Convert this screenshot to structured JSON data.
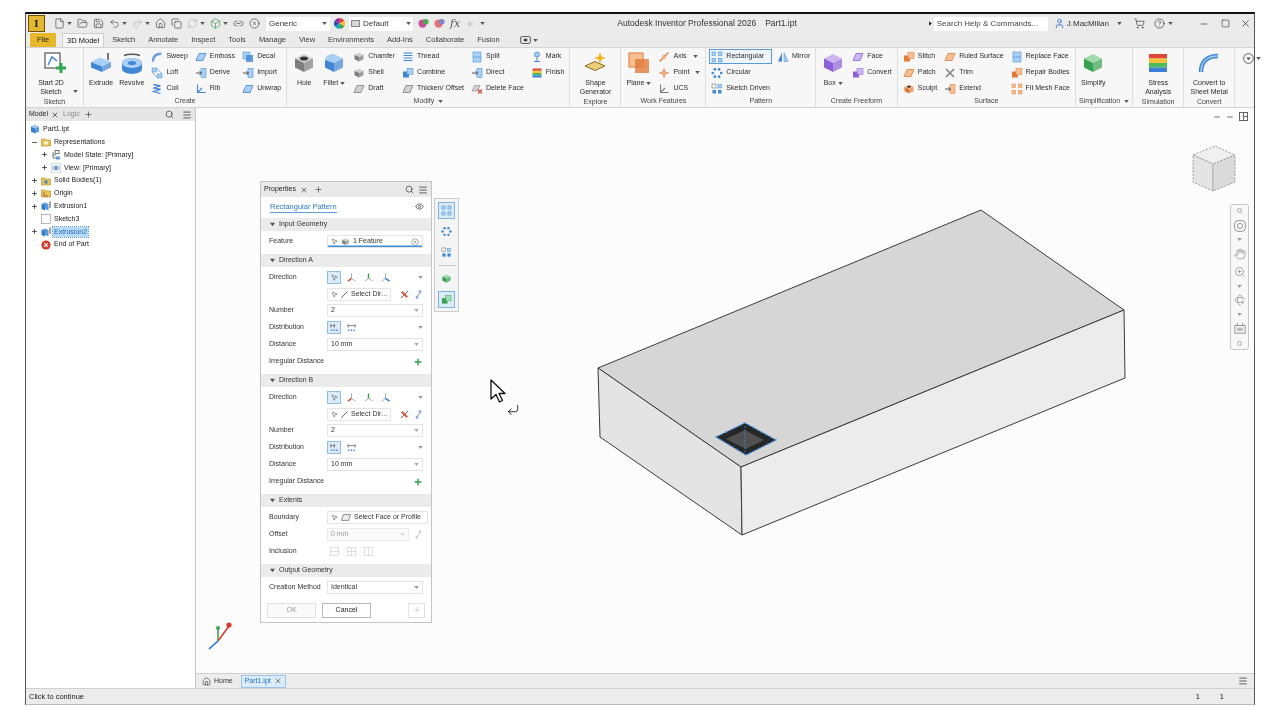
{
  "title_bar": {
    "app_logo": "I",
    "material": "Generic",
    "appearance": "Default",
    "parameters": "fx",
    "title": "Autodesk Inventor Professional 2026",
    "document": "Part1.ipt",
    "search": {
      "placeholder": "Search Help & Commands..."
    },
    "user": "J.MacMillan"
  },
  "ribbon_tabs": [
    {
      "label": "File",
      "kind": "file",
      "selected": false
    },
    {
      "label": "3D Model",
      "kind": "tab",
      "selected": true
    },
    {
      "label": "Sketch",
      "kind": "tab",
      "selected": false
    },
    {
      "label": "Annotate",
      "kind": "tab",
      "selected": false
    },
    {
      "label": "Inspect",
      "kind": "tab",
      "selected": false
    },
    {
      "label": "Tools",
      "kind": "tab",
      "selected": false
    },
    {
      "label": "Manage",
      "kind": "tab",
      "selected": false
    },
    {
      "label": "View",
      "kind": "tab",
      "selected": false
    },
    {
      "label": "Environments",
      "kind": "tab",
      "selected": false
    },
    {
      "label": "Add-Ins",
      "kind": "tab",
      "selected": false
    },
    {
      "label": "Collaborate",
      "kind": "tab",
      "selected": false
    },
    {
      "label": "Fusion",
      "kind": "tab",
      "selected": false
    }
  ],
  "ribbon_panels": [
    {
      "label": "Sketch",
      "columns": [
        {
          "kind": "large",
          "tools": [
            {
              "label": "Start 2D Sketch",
              "dropdown": true,
              "selected": false
            }
          ]
        }
      ]
    },
    {
      "label": "Create",
      "columns": [
        {
          "kind": "large",
          "tools": [
            {
              "label": "Extrude",
              "selected": false
            },
            {
              "label": "Revolve",
              "selected": false
            }
          ]
        },
        {
          "kind": "small",
          "tools": [
            {
              "label": "Sweep",
              "selected": false
            },
            {
              "label": "Loft",
              "selected": false
            },
            {
              "label": "Coil",
              "selected": false
            }
          ]
        },
        {
          "kind": "small",
          "tools": [
            {
              "label": "Emboss",
              "selected": false
            },
            {
              "label": "Derive",
              "selected": false
            },
            {
              "label": "Rib",
              "selected": false
            }
          ]
        },
        {
          "kind": "small",
          "tools": [
            {
              "label": "Decal",
              "selected": false
            },
            {
              "label": "Import",
              "selected": false
            },
            {
              "label": "Unwrap",
              "selected": false
            }
          ]
        }
      ]
    },
    {
      "label": "Modify",
      "menu": true,
      "columns": [
        {
          "kind": "large",
          "tools": [
            {
              "label": "Hole",
              "selected": false
            },
            {
              "label": "Fillet",
              "dropdown": true,
              "selected": false
            }
          ]
        },
        {
          "kind": "small",
          "tools": [
            {
              "label": "Chamfer",
              "selected": false
            },
            {
              "label": "Shell",
              "selected": false
            },
            {
              "label": "Draft",
              "selected": false
            }
          ]
        },
        {
          "kind": "small",
          "tools": [
            {
              "label": "Thread",
              "selected": false
            },
            {
              "label": "Combine",
              "selected": false
            },
            {
              "label": "Thicken/ Offset",
              "selected": false
            }
          ]
        },
        {
          "kind": "small",
          "tools": [
            {
              "label": "Split",
              "selected": false
            },
            {
              "label": "Direct",
              "selected": false
            },
            {
              "label": "Delete Face",
              "selected": false
            }
          ]
        },
        {
          "kind": "small",
          "tools": [
            {
              "label": "Mark",
              "selected": false
            },
            {
              "label": "Finish",
              "selected": false
            }
          ]
        }
      ]
    },
    {
      "label": "Explore",
      "columns": [
        {
          "kind": "large",
          "tools": [
            {
              "label": "Shape Generator",
              "selected": false
            }
          ]
        }
      ]
    },
    {
      "label": "Work Features",
      "columns": [
        {
          "kind": "large",
          "tools": [
            {
              "label": "Plane",
              "dropdown": true,
              "selected": false
            }
          ]
        },
        {
          "kind": "small",
          "tools": [
            {
              "label": "Axis",
              "dropdown": true,
              "selected": false
            },
            {
              "label": "Point",
              "dropdown": true,
              "selected": false
            },
            {
              "label": "UCS",
              "selected": false
            }
          ]
        }
      ]
    },
    {
      "label": "Pattern",
      "columns": [
        {
          "kind": "small",
          "tools": [
            {
              "label": "Rectangular",
              "selected": true
            },
            {
              "label": "Circular",
              "selected": false
            },
            {
              "label": "Sketch Driven",
              "selected": false
            }
          ]
        },
        {
          "kind": "small",
          "tools": [
            {
              "label": "Mirror",
              "selected": false
            }
          ]
        }
      ]
    },
    {
      "label": "Create Freeform",
      "columns": [
        {
          "kind": "large",
          "tools": [
            {
              "label": "Box",
              "dropdown": true,
              "selected": false
            }
          ]
        },
        {
          "kind": "small",
          "tools": [
            {
              "label": "Face",
              "selected": false
            },
            {
              "label": "Convert",
              "selected": false
            }
          ]
        }
      ]
    },
    {
      "label": "Surface",
      "columns": [
        {
          "kind": "small",
          "tools": [
            {
              "label": "Stitch",
              "selected": false
            },
            {
              "label": "Patch",
              "selected": false
            },
            {
              "label": "Sculpt",
              "selected": false
            }
          ]
        },
        {
          "kind": "small",
          "tools": [
            {
              "label": "Ruled Surface",
              "selected": false
            },
            {
              "label": "Trim",
              "selected": false
            },
            {
              "label": "Extend",
              "selected": false
            }
          ]
        },
        {
          "kind": "small",
          "tools": [
            {
              "label": "Replace Face",
              "selected": false
            },
            {
              "label": "Repair Bodies",
              "selected": false
            },
            {
              "label": "Fit Mesh Face",
              "selected": false
            }
          ]
        }
      ]
    },
    {
      "label": "Simplification",
      "menu": true,
      "columns": [
        {
          "kind": "large",
          "tools": [
            {
              "label": "Simplify",
              "selected": false
            }
          ]
        }
      ]
    },
    {
      "label": "Simulation",
      "columns": [
        {
          "kind": "large",
          "tools": [
            {
              "label": "Stress Analysis",
              "selected": false
            }
          ]
        }
      ]
    },
    {
      "label": "Convert",
      "columns": [
        {
          "kind": "large",
          "tools": [
            {
              "label": "Convert to Sheet Metal",
              "selected": false
            }
          ]
        }
      ]
    }
  ],
  "browser": {
    "tabs": [
      {
        "label": "Model",
        "selected": true
      },
      {
        "label": "Logic",
        "selected": false
      }
    ],
    "tree": [
      {
        "label": "Part1.ipt",
        "kind": "part",
        "selected": false,
        "children": [
          {
            "label": "Representations",
            "kind": "folder",
            "expanded": true,
            "selected": false,
            "children": [
              {
                "label": "Model State: [Primary]",
                "kind": "state",
                "expanded": false,
                "selected": false
              },
              {
                "label": "View: [Primary]",
                "kind": "view",
                "expanded": false,
                "selected": false
              }
            ]
          },
          {
            "label": "Solid Bodies(1)",
            "kind": "bodies",
            "expanded": false,
            "selected": false
          },
          {
            "label": "Origin",
            "kind": "origin",
            "expanded": false,
            "selected": false
          },
          {
            "label": "Extrusion1",
            "kind": "extrusion",
            "expanded": false,
            "selected": false
          },
          {
            "label": "Sketch3",
            "kind": "sketch",
            "selected": false
          },
          {
            "label": "Extrusion2",
            "kind": "extrusion",
            "expanded": false,
            "selected": true
          },
          {
            "label": "End of Part",
            "kind": "end",
            "selected": false
          }
        ]
      }
    ]
  },
  "properties": {
    "tabs": [
      {
        "label": "Properties",
        "selected": true
      }
    ],
    "title": "Rectangular Pattern",
    "pattern_types": [
      {
        "selected": true
      },
      {
        "selected": false
      },
      {
        "selected": false
      }
    ],
    "output_types": [
      {
        "selected": false
      },
      {
        "selected": true
      }
    ],
    "sections": [
      {
        "title": "Input Geometry",
        "expanded": true,
        "rows": [
          {
            "kind": "selection",
            "label": "Feature",
            "value": "1 Feature",
            "focused": true
          }
        ]
      },
      {
        "title": "Direction A",
        "expanded": true,
        "rows": [
          {
            "kind": "direction",
            "label": "Direction",
            "options": [
              {
                "selected": true
              },
              {
                "selected": false
              },
              {
                "selected": false
              },
              {
                "selected": false
              }
            ],
            "selection": "Select Dir…"
          },
          {
            "kind": "value",
            "label": "Number",
            "value": "2"
          },
          {
            "kind": "toggles",
            "label": "Distribution",
            "options": [
              {
                "selected": true
              },
              {
                "selected": false
              }
            ]
          },
          {
            "kind": "value",
            "label": "Distance",
            "value": "10 mm"
          },
          {
            "kind": "add",
            "label": "Irregular Distance"
          }
        ]
      },
      {
        "title": "Direction B",
        "expanded": true,
        "rows": [
          {
            "kind": "direction",
            "label": "Direction",
            "options": [
              {
                "selected": true
              },
              {
                "selected": false
              },
              {
                "selected": false
              },
              {
                "selected": false
              }
            ],
            "selection": "Select Dir…"
          },
          {
            "kind": "value",
            "label": "Number",
            "value": "2"
          },
          {
            "kind": "toggles",
            "label": "Distribution",
            "options": [
              {
                "selected": true
              },
              {
                "selected": false
              }
            ]
          },
          {
            "kind": "value",
            "label": "Distance",
            "value": "10 mm"
          },
          {
            "kind": "add",
            "label": "Irregular Distance"
          }
        ]
      },
      {
        "title": "Extents",
        "expanded": true,
        "rows": [
          {
            "kind": "selection",
            "label": "Boundary",
            "value": "Select Face or Profile",
            "focused": false
          },
          {
            "kind": "value",
            "label": "Offset",
            "value": "0 mm",
            "disabled": true
          },
          {
            "kind": "toggles",
            "label": "Inclusion",
            "disabled": true,
            "options": [
              {
                "selected": false
              },
              {
                "selected": false
              },
              {
                "selected": false
              }
            ]
          }
        ]
      },
      {
        "title": "Output Geometry",
        "expanded": true,
        "rows": [
          {
            "kind": "choice",
            "label": "Creation Method",
            "value": "Identical"
          }
        ]
      }
    ],
    "buttons": [
      {
        "label": "OK",
        "disabled": true
      },
      {
        "label": "Cancel",
        "disabled": false
      }
    ]
  },
  "document_tabs": [
    {
      "label": "Home",
      "kind": "home",
      "selected": false
    },
    {
      "label": "Part1.ipt",
      "kind": "document",
      "selected": true
    }
  ],
  "status_bar": {
    "message": "Click to continue",
    "fields": [
      "1",
      "1"
    ]
  }
}
